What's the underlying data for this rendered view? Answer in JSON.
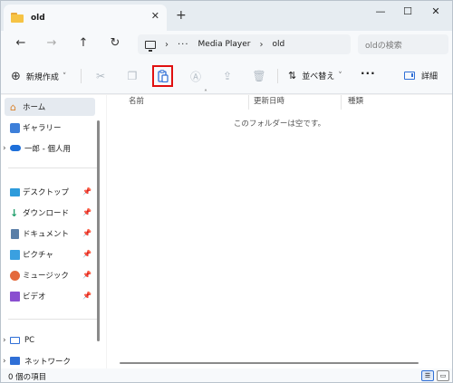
{
  "tab": {
    "title": "old"
  },
  "address": {
    "segments": [
      "Media Player",
      "old"
    ],
    "ellipsis": "···"
  },
  "search": {
    "placeholder": "oldの検索"
  },
  "toolbar": {
    "new_label": "新規作成",
    "sort_label": "並べ替え",
    "detail_label": "詳細"
  },
  "nav": {
    "home": "ホーム",
    "gallery": "ギャラリー",
    "onedrive": "一郎 - 個人用",
    "quick": [
      {
        "label": "デスクトップ"
      },
      {
        "label": "ダウンロード"
      },
      {
        "label": "ドキュメント"
      },
      {
        "label": "ピクチャ"
      },
      {
        "label": "ミュージック"
      },
      {
        "label": "ビデオ"
      }
    ],
    "pc": "PC",
    "network": "ネットワーク"
  },
  "columns": {
    "name": "名前",
    "modified": "更新日時",
    "type": "種類"
  },
  "content": {
    "empty_message": "このフォルダーは空です。"
  },
  "status": {
    "count": "0 個の項目"
  },
  "colors": {
    "accent": "#2f6fd6",
    "highlight": "#e01010",
    "folder": "#f6c344"
  }
}
